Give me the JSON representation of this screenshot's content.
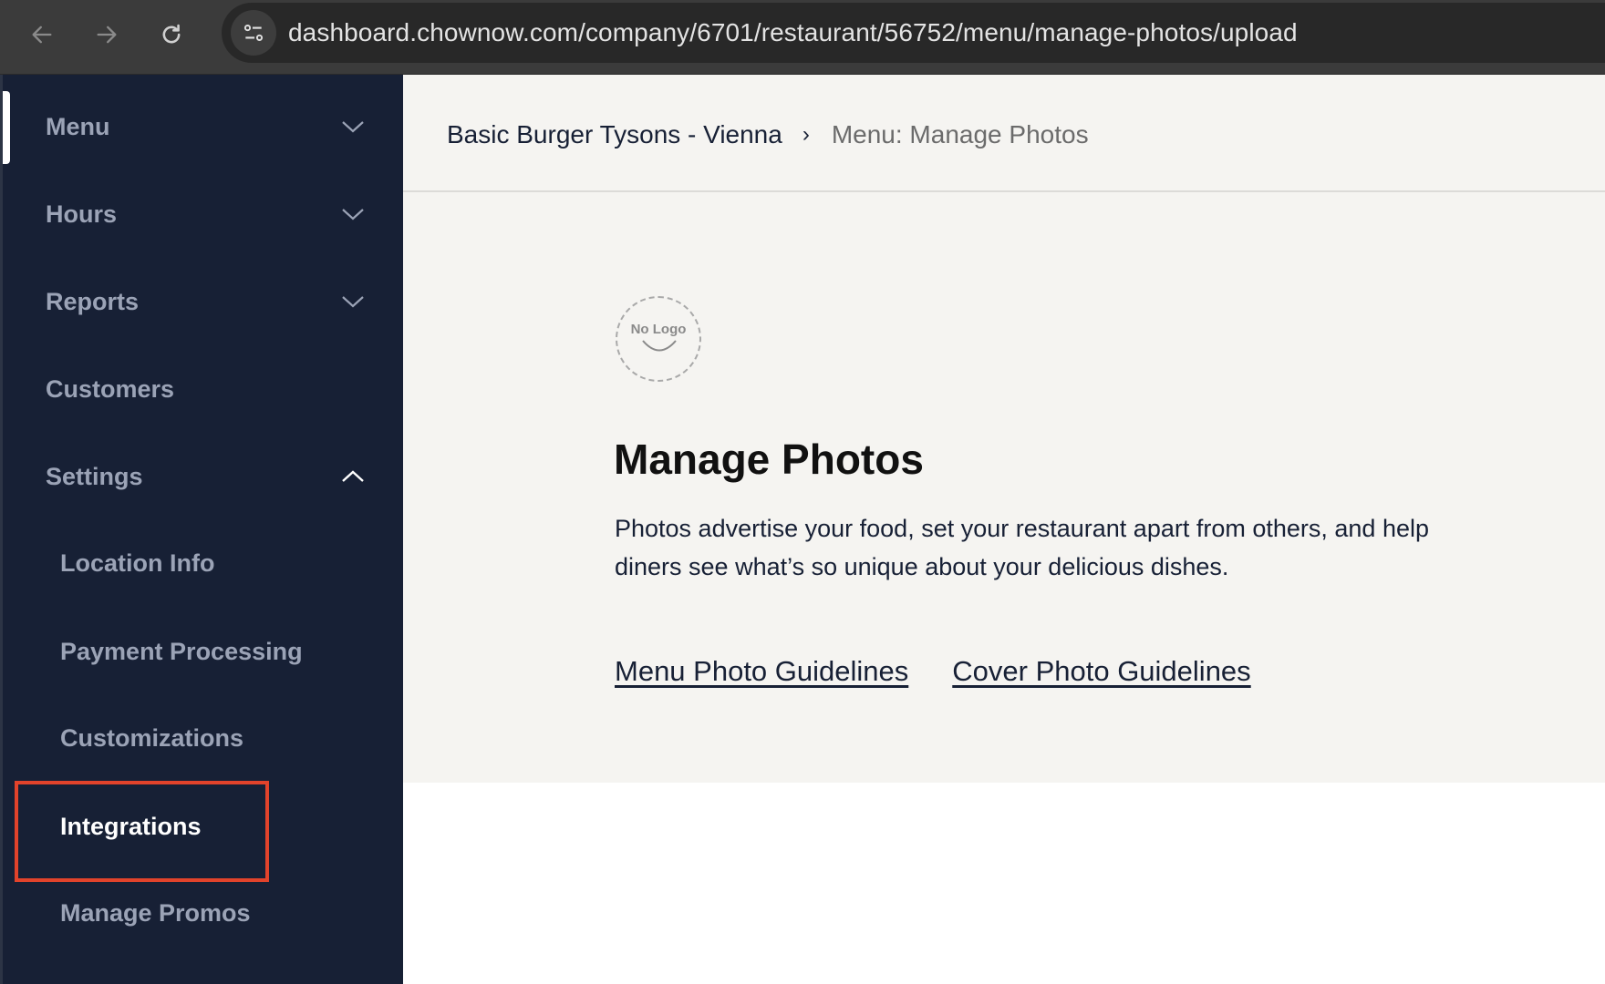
{
  "browser": {
    "url": "dashboard.chownow.com/company/6701/restaurant/56752/menu/manage-photos/upload",
    "icons": [
      "back-arrow-icon",
      "forward-arrow-icon",
      "reload-icon",
      "site-settings-icon"
    ]
  },
  "sidebar": {
    "items": [
      {
        "label": "Menu",
        "expandable": true,
        "expanded": false
      },
      {
        "label": "Hours",
        "expandable": true,
        "expanded": false
      },
      {
        "label": "Reports",
        "expandable": true,
        "expanded": false
      },
      {
        "label": "Customers",
        "expandable": false
      },
      {
        "label": "Settings",
        "expandable": true,
        "expanded": true
      },
      {
        "label": "Location Info",
        "sub": true
      },
      {
        "label": "Payment Processing",
        "sub": true
      },
      {
        "label": "Customizations",
        "sub": true
      },
      {
        "label": "Integrations",
        "sub": true,
        "highlighted": true
      },
      {
        "label": "Manage Promos",
        "sub": true
      }
    ]
  },
  "breadcrumb": {
    "restaurant": "Basic Burger Tysons - Vienna",
    "separator": "›",
    "current": "Menu: Manage Photos"
  },
  "content": {
    "logo_placeholder": "No Logo",
    "title": "Manage Photos",
    "description": "Photos advertise your food, set your restaurant apart from others, and help diners see what’s so unique about your delicious dishes.",
    "links": [
      "Menu Photo Guidelines",
      "Cover Photo Guidelines"
    ]
  },
  "colors": {
    "sidebar_bg": "#172035",
    "sidebar_text": "#9ba3b6",
    "highlight_box": "#e2432b",
    "content_bg": "#f5f4f1",
    "text_dark": "#172035"
  }
}
